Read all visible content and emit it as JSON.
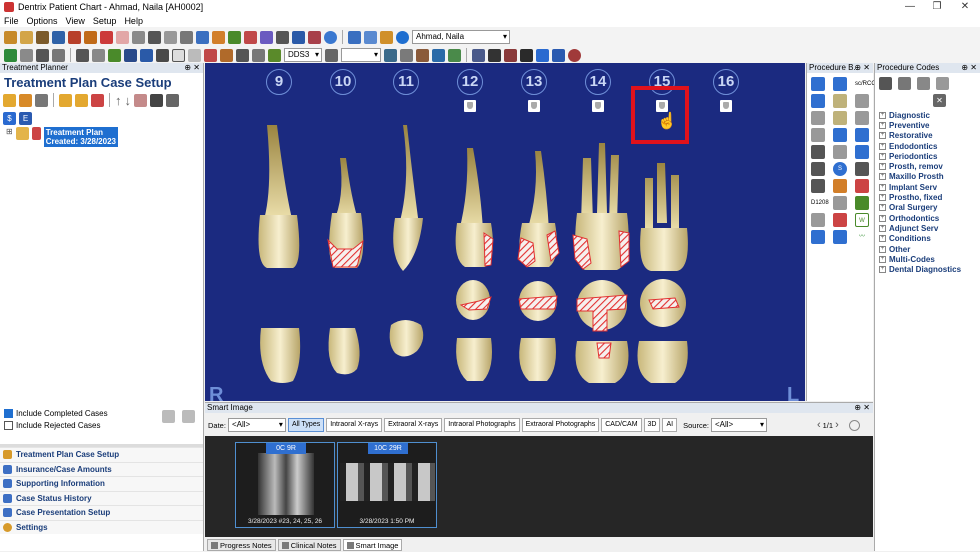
{
  "window": {
    "title": "Dentrix Patient Chart - Ahmad, Naila [AH0002]"
  },
  "menu": [
    "File",
    "Options",
    "View",
    "Setup",
    "Help"
  ],
  "toolbar": {
    "patient_name": "Ahmad, Naila",
    "provider": "DDS3"
  },
  "left_panel": {
    "header": "Treatment Planner",
    "title": "Treatment Plan Case Setup",
    "tree": {
      "line1": "Treatment Plan",
      "line2": "Created: 3/28/2023"
    },
    "checks": [
      {
        "label": "Include Completed Cases",
        "checked": true
      },
      {
        "label": "Include Rejected Cases",
        "checked": false
      }
    ],
    "nav": [
      {
        "label": "Treatment Plan Case Setup",
        "color": "#d79a2a"
      },
      {
        "label": "Insurance/Case Amounts",
        "color": "#3d6fc4"
      },
      {
        "label": "Supporting Information",
        "color": "#3d6fc4"
      },
      {
        "label": "Case Status History",
        "color": "#3d6fc4"
      },
      {
        "label": "Case Presentation Setup",
        "color": "#3d6fc4"
      },
      {
        "label": "Settings",
        "color": "#d79a2a"
      }
    ]
  },
  "chart": {
    "teeth": [
      "9",
      "10",
      "11",
      "12",
      "13",
      "14",
      "15",
      "16"
    ],
    "letters": {
      "left": "R",
      "right": "L"
    }
  },
  "procedure_buttons": {
    "header": "Procedure B...",
    "labels": [
      "sc/RCC",
      "D1208"
    ]
  },
  "procedure_codes": {
    "header": "Procedure Codes",
    "items": [
      "Diagnostic",
      "Preventive",
      "Restorative",
      "Endodontics",
      "Periodontics",
      "Prosth, remov",
      "Maxillo Prosth",
      "Implant Serv",
      "Prostho, fixed",
      "Oral Surgery",
      "Orthodontics",
      "Adjunct Serv",
      "Conditions",
      "Other",
      "Multi-Codes",
      "Dental Diagnostics"
    ]
  },
  "smart_image": {
    "header": "Smart Image",
    "date_label": "Date:",
    "date_value": "<All>",
    "tabs": [
      "All Types",
      "Intraoral X-rays",
      "Extraoral X-rays",
      "Intraoral Photographs",
      "Extraoral Photographs",
      "CAD/CAM",
      "3D",
      "AI"
    ],
    "source_label": "Source:",
    "source_value": "<All>",
    "pager": "1/1",
    "thumbs": [
      {
        "badge": "0C 9R",
        "caption": "3/28/2023 #23, 24, 25, 26"
      },
      {
        "badge": "10C 29R",
        "caption": "3/28/2023 1:50 PM"
      }
    ],
    "bottom_tabs": [
      "Progress Notes",
      "Clinical Notes",
      "Smart Image"
    ]
  }
}
